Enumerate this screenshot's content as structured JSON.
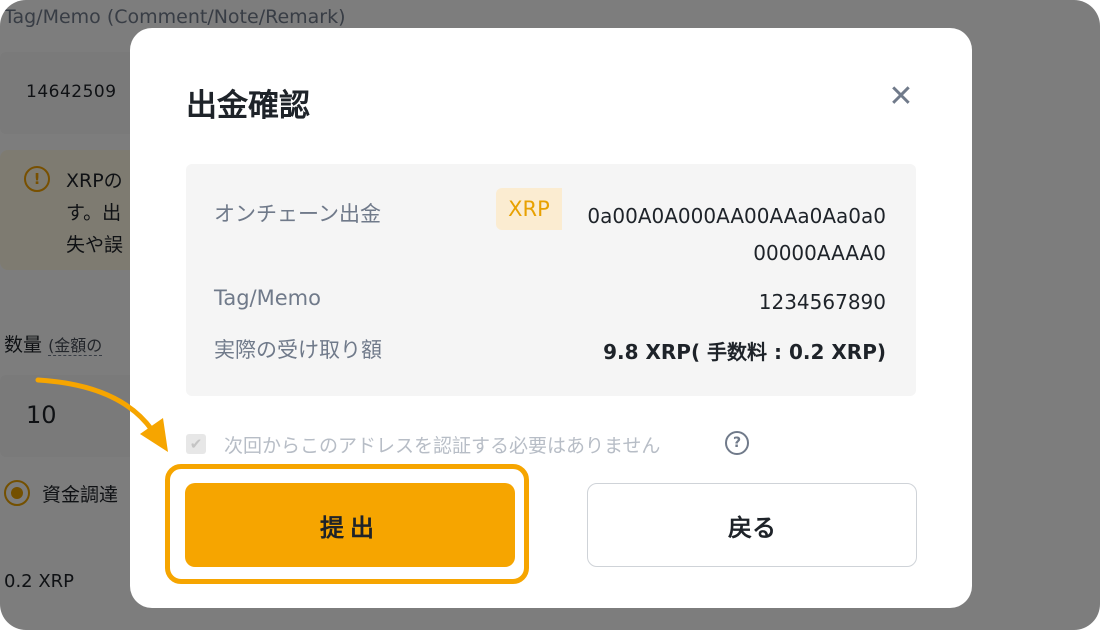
{
  "background": {
    "tag_label": "Tag/Memo (Comment/Note/Remark)",
    "tag_value": "14642509",
    "warning_lines": [
      "XRPの",
      "す。出",
      "失や誤"
    ],
    "quantity_label": "数量",
    "quantity_hint": "(金額の",
    "quantity_value": "10",
    "radio_label": "資金調達",
    "fee": "0.2 XRP"
  },
  "modal": {
    "title": "出金確認",
    "close_icon": "close-icon",
    "rows": {
      "onchain_label": "オンチェーン出金",
      "coin_tag": "XRP",
      "address_line1": "0a00A0A000AA00AAa0Aa0a0",
      "address_line2": "00000AAAA0",
      "memo_label": "Tag/Memo",
      "memo_value": "1234567890",
      "received_label": "実際の受け取り額",
      "received_value": "9.8 XRP( 手数料 : 0.2 XRP)"
    },
    "checkbox_label": "次回からこのアドレスを認証する必要はありません",
    "help_icon": "?",
    "submit_label": "提出",
    "back_label": "戻る"
  },
  "colors": {
    "accent": "#f6a500",
    "text": "#1e2329",
    "muted": "#707a8a"
  }
}
